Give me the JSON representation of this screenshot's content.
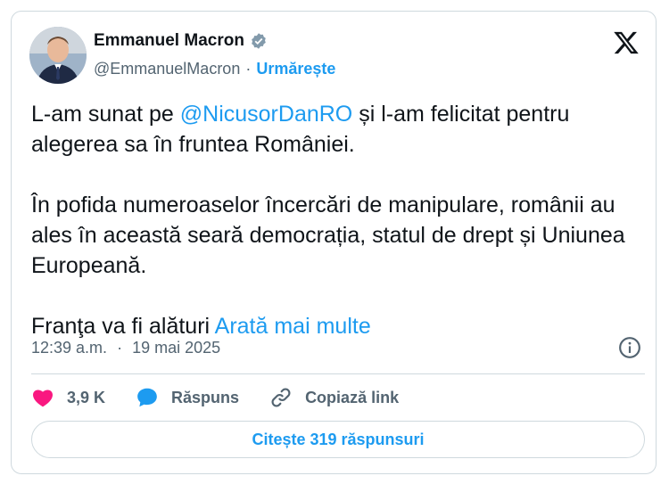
{
  "author": {
    "name": "Emmanuel Macron",
    "handle": "@EmmanuelMacron",
    "separator": "·",
    "follow_label": "Urmărește"
  },
  "tweet": {
    "line1_pre": "L-am sunat pe ",
    "mention": "@NicusorDanRO",
    "line1_post": " și l-am felicitat pentru alegerea sa în fruntea României.",
    "paragraph2": "În pofida numeroaselor încercări de manipulare, românii au ales în această seară democrația, statul de drept și Uniunea Europeană.",
    "paragraph3_pre": "Franţa va fi alături ",
    "show_more": "Arată mai multe"
  },
  "meta": {
    "time": "12:39 a.m.",
    "separator": "·",
    "date": "19 mai 2025"
  },
  "actions": {
    "likes": "3,9 K",
    "reply_label": "Răspuns",
    "copy_link_label": "Copiază link"
  },
  "read_replies_label": "Citește 319 răspunsuri",
  "colors": {
    "accent": "#1d9bf0",
    "like": "#f91880",
    "text": "#0f1419",
    "secondary": "#536471",
    "border": "#cfd9de"
  },
  "icons": {
    "verified": "verified-badge-icon",
    "logo": "x-logo-icon",
    "info": "info-icon",
    "like": "heart-icon",
    "reply": "speech-bubble-icon",
    "link": "link-icon"
  }
}
